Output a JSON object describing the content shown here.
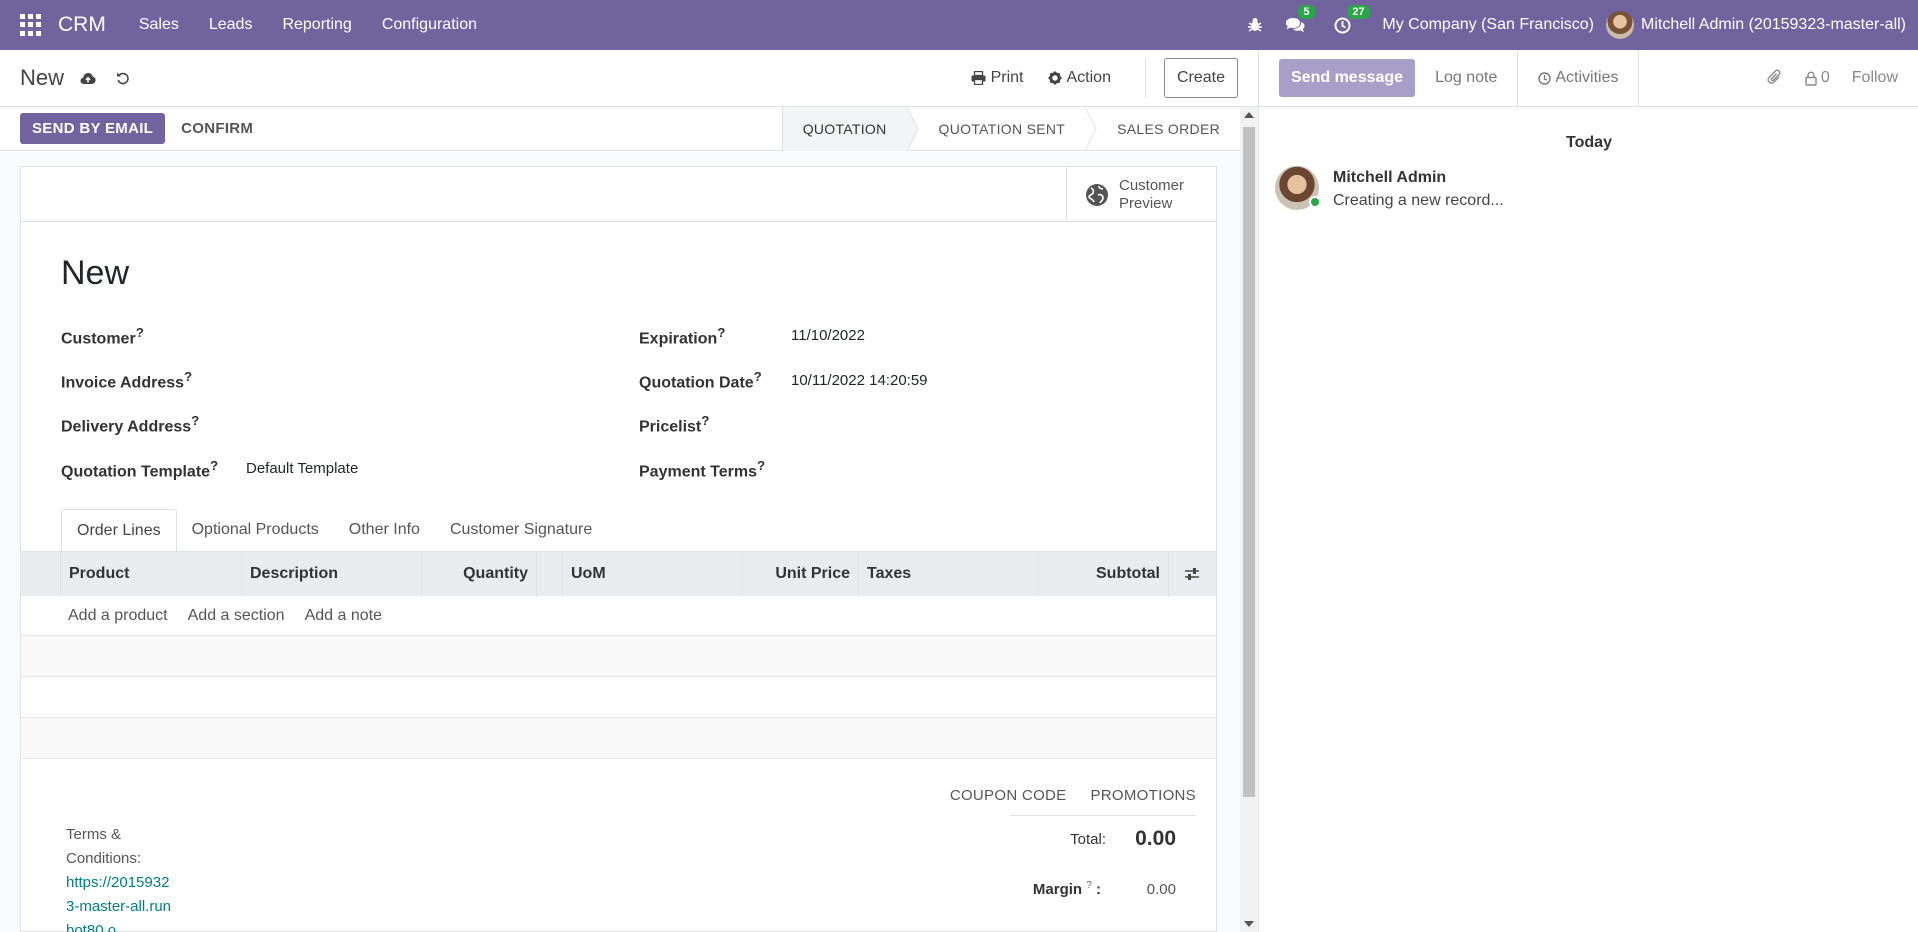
{
  "navbar": {
    "brand": "CRM",
    "menu": [
      "Sales",
      "Leads",
      "Reporting",
      "Configuration"
    ],
    "messages_badge": "5",
    "activities_badge": "27",
    "company": "My Company (San Francisco)",
    "user": "Mitchell Admin (20159323-master-all)",
    "color": "#71639e"
  },
  "control": {
    "breadcrumb": "New",
    "print_label": "Print",
    "action_label": "Action",
    "create_label": "Create"
  },
  "statusbar": {
    "send_email_label": "SEND BY EMAIL",
    "confirm_label": "CONFIRM",
    "stages": [
      "QUOTATION",
      "QUOTATION SENT",
      "SALES ORDER"
    ],
    "active_stage": "QUOTATION"
  },
  "sheet": {
    "preview_line1": "Customer",
    "preview_line2": "Preview",
    "title": "New",
    "fields": {
      "customer": {
        "label": "Customer",
        "value": ""
      },
      "invoice_address": {
        "label": "Invoice Address",
        "value": ""
      },
      "delivery_address": {
        "label": "Delivery Address",
        "value": ""
      },
      "quotation_template": {
        "label": "Quotation Template",
        "value": "Default Template"
      },
      "expiration": {
        "label": "Expiration",
        "value": "11/10/2022"
      },
      "quotation_date": {
        "label": "Quotation Date",
        "value": "10/11/2022 14:20:59"
      },
      "pricelist": {
        "label": "Pricelist",
        "value": ""
      },
      "payment_terms": {
        "label": "Payment Terms",
        "value": ""
      }
    },
    "help_mark": "?",
    "tabs": [
      "Order Lines",
      "Optional Products",
      "Other Info",
      "Customer Signature"
    ],
    "columns": [
      "Product",
      "Description",
      "Quantity",
      "UoM",
      "Unit Price",
      "Taxes",
      "Subtotal"
    ],
    "add_links": [
      "Add a product",
      "Add a section",
      "Add a note"
    ],
    "coupon_label": "COUPON CODE",
    "promotions_label": "PROMOTIONS",
    "total_label": "Total:",
    "total_value": "0.00",
    "margin_label": "Margin",
    "margin_value": "0.00",
    "terms_label": "Terms & Conditions:",
    "terms_link": "https://20159323-master-all.runbot80.o"
  },
  "chatter": {
    "send_message_label": "Send message",
    "log_note_label": "Log note",
    "activities_label": "Activities",
    "followers_count": "0",
    "follow_label": "Follow",
    "date_separator": "Today",
    "message_author": "Mitchell Admin",
    "message_text": "Creating a new record..."
  }
}
